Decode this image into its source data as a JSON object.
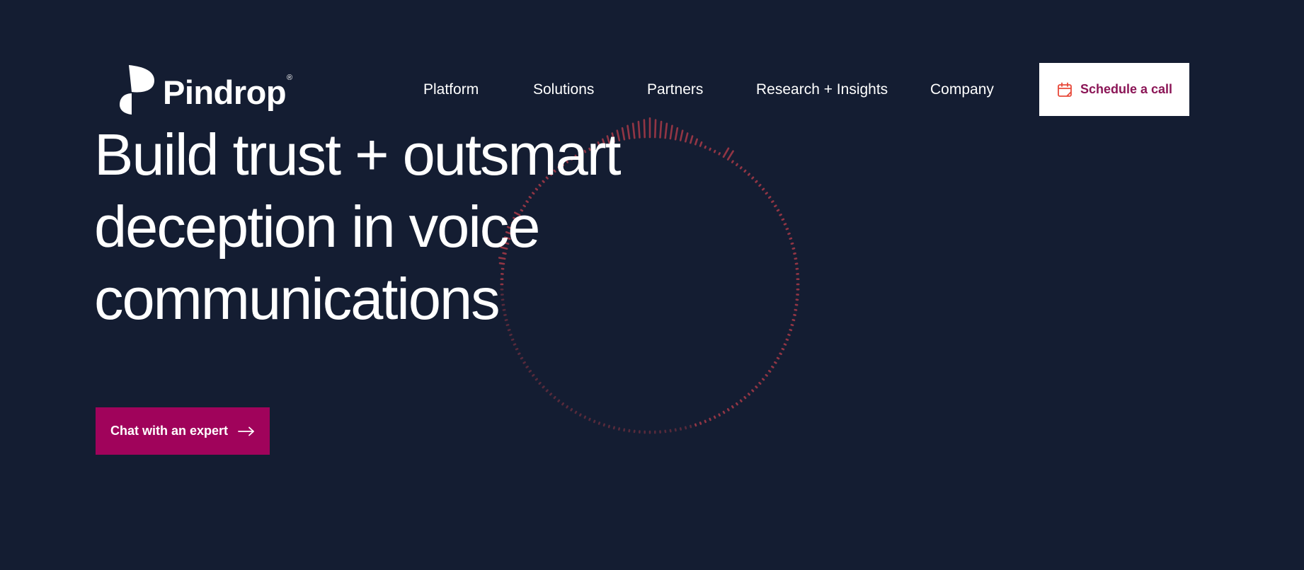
{
  "brand": {
    "name": "Pindrop",
    "registered_mark": "®"
  },
  "nav": {
    "items": [
      {
        "label": "Platform"
      },
      {
        "label": "Solutions"
      },
      {
        "label": "Partners"
      },
      {
        "label": "Research + Insights"
      },
      {
        "label": "Company"
      }
    ]
  },
  "header_cta": {
    "label": "Schedule a call",
    "icon": "calendar-icon"
  },
  "hero": {
    "headline_lines": [
      "Build trust + outsmart",
      "deception in voice",
      "communications"
    ],
    "cta": {
      "label": "Chat with an expert",
      "icon": "arrow-right-icon"
    }
  },
  "decor": {
    "waveform_ring_icon": "audio-waveform-ring"
  },
  "colors": {
    "background": "#141d32",
    "accent_magenta": "#a0035b",
    "button_text": "#8b1556",
    "icon_orange": "#e8493a",
    "ring_red": "#a83a48",
    "text": "#ffffff"
  }
}
